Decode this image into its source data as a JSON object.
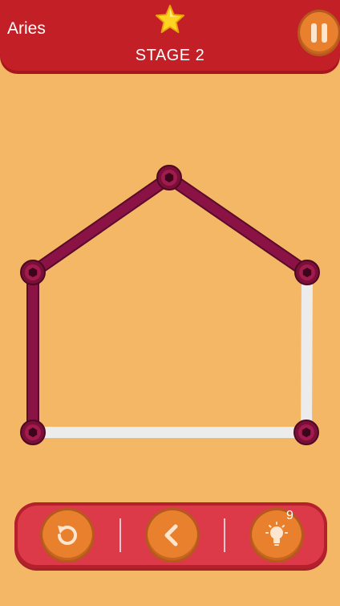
{
  "header": {
    "level_name": "Aries",
    "stage_label": "STAGE 2",
    "star_icon": "star-icon",
    "pause_icon": "pause-icon"
  },
  "puzzle": {
    "nodes": [
      {
        "id": "top"
      },
      {
        "id": "upper-left"
      },
      {
        "id": "upper-right"
      },
      {
        "id": "bottom-left"
      },
      {
        "id": "bottom-right"
      }
    ],
    "edges": [
      {
        "from": "upper-left",
        "to": "top",
        "drawn": true
      },
      {
        "from": "top",
        "to": "upper-right",
        "drawn": true
      },
      {
        "from": "upper-left",
        "to": "bottom-left",
        "drawn": true
      },
      {
        "from": "upper-right",
        "to": "bottom-right",
        "drawn": false
      },
      {
        "from": "bottom-left",
        "to": "bottom-right",
        "drawn": false
      }
    ],
    "drawn_color": "#8a1245",
    "undrawn_color": "#ececec",
    "node_color": "#7a0f38"
  },
  "controls": {
    "restart_icon": "restart-icon",
    "undo_icon": "back-arrow-icon",
    "hint_icon": "lightbulb-icon",
    "hint_count": "9"
  },
  "colors": {
    "background": "#f4b765",
    "header": "#c21f26",
    "button": "#e9802d",
    "control_bar": "#dc3a48"
  }
}
